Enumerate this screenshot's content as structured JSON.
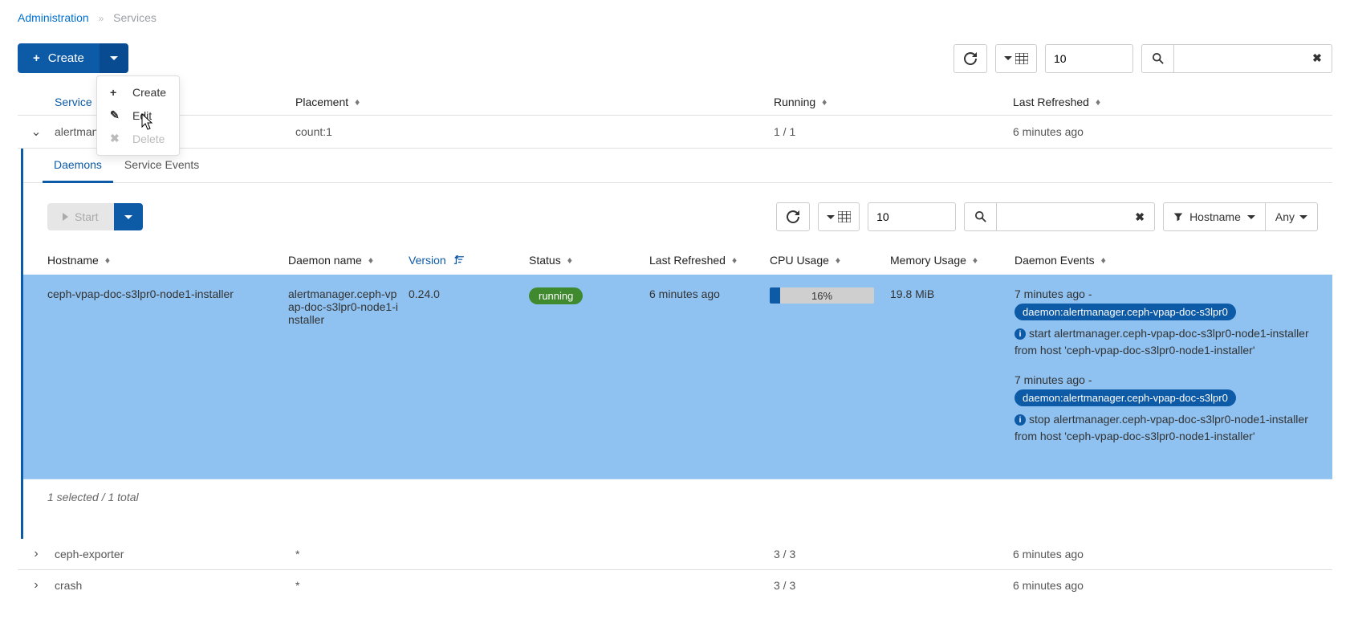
{
  "breadcrumbs": {
    "root": "Administration",
    "current": "Services"
  },
  "createBtn": {
    "label": "Create"
  },
  "dropdown": {
    "create": "Create",
    "edit": "Edit",
    "delete": "Delete"
  },
  "topToolbar": {
    "pageSize": "10"
  },
  "servicesHeaders": {
    "service": "Service",
    "placement": "Placement",
    "running": "Running",
    "lastRefreshed": "Last Refreshed"
  },
  "serviceRow": {
    "name": "alertmanager",
    "placement": "count:1",
    "running": "1 / 1",
    "refreshed": "6 minutes ago"
  },
  "tabs": {
    "daemons": "Daemons",
    "events": "Service Events"
  },
  "daemonToolbar": {
    "start": "Start",
    "pageSize": "10",
    "filterLabel": "Hostname",
    "any": "Any"
  },
  "daemonHeaders": {
    "hostname": "Hostname",
    "daemonName": "Daemon name",
    "version": "Version",
    "status": "Status",
    "lastRefreshed": "Last Refreshed",
    "cpu": "CPU Usage",
    "memory": "Memory Usage",
    "events": "Daemon Events"
  },
  "daemonRow": {
    "hostname": "ceph-vpap-doc-s3lpr0-node1-installer",
    "daemonName": "alertmanager.ceph-vpap-doc-s3lpr0-node1-installer",
    "version": "0.24.0",
    "status": "running",
    "lastRefreshed": "6 minutes ago",
    "cpuPct": "16%",
    "cpuWidth": "10%",
    "memory": "19.8 MiB"
  },
  "daemonEvents": [
    {
      "time": "7 minutes ago -",
      "chip": "daemon:alertmanager.ceph-vpap-doc-s3lpr0",
      "desc": "start alertmanager.ceph-vpap-doc-s3lpr0-node1-installer from host 'ceph-vpap-doc-s3lpr0-node1-installer'"
    },
    {
      "time": "7 minutes ago -",
      "chip": "daemon:alertmanager.ceph-vpap-doc-s3lpr0",
      "desc": "stop alertmanager.ceph-vpap-doc-s3lpr0-node1-installer from host 'ceph-vpap-doc-s3lpr0-node1-installer'"
    }
  ],
  "selectionFooter": "1 selected / 1 total",
  "otherRows": [
    {
      "name": "ceph-exporter",
      "placement": "*",
      "running": "3 / 3",
      "refreshed": "6 minutes ago"
    },
    {
      "name": "crash",
      "placement": "*",
      "running": "3 / 3",
      "refreshed": "6 minutes ago"
    }
  ]
}
